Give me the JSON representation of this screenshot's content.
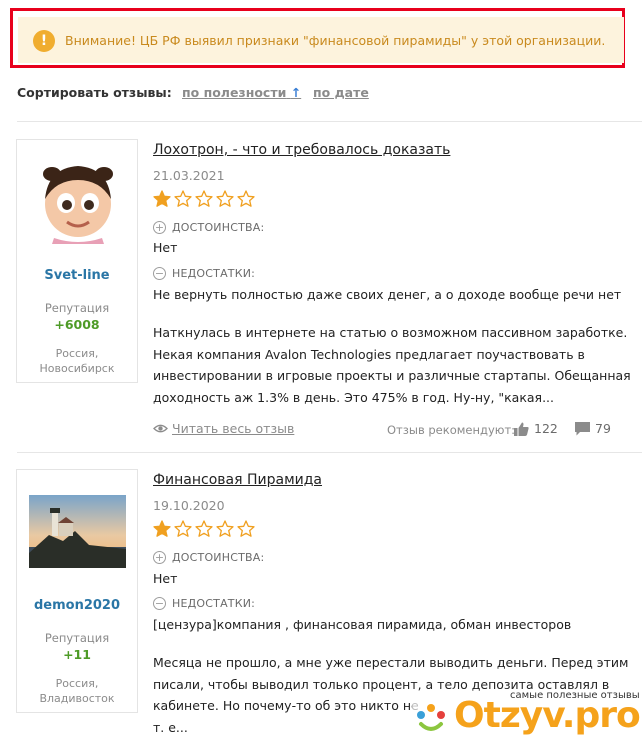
{
  "warning": {
    "icon": "exclamation-icon",
    "text": "Внимание! ЦБ РФ выявил признаки \"финансовой пирамиды\" у этой организации."
  },
  "sort": {
    "label": "Сортировать отзывы:",
    "by_usefulness": "по полезности",
    "by_date": "по дате"
  },
  "reviews": [
    {
      "author": "Svet-line",
      "rep_label": "Репутация",
      "rep_value": "+6008",
      "country": "Россия,",
      "city": "Новосибирск",
      "title": "Лохотрон, - что и требовалось доказать",
      "date": "21.03.2021",
      "rating": 1,
      "pros_label": "ДОСТОИНСТВА:",
      "pros": "Нет",
      "cons_label": "НЕДОСТАТКИ:",
      "cons": "Не вернуть полностью даже своих денег, а о доходе вообще речи нет",
      "body": [
        "Наткнулась в интернете на статью о возможном пассивном заработке.",
        "Некая компания Avalon Technologies предлагает поучаствовать в",
        "инвестировании в игровые проекты и различные стартапы. Обещанная",
        "доходность аж 1.3% в день. Это 475% в год. Ну-ну, \"какая..."
      ],
      "read_full": "Читать весь отзыв",
      "recommended_label": "Отзыв рекомендуют:",
      "likes": "122",
      "comments": "79"
    },
    {
      "author": "demon2020",
      "rep_label": "Репутация",
      "rep_value": "+11",
      "country": "Россия,",
      "city": "Владивосток",
      "title": "Финансовая Пирамида",
      "date": "19.10.2020",
      "rating": 1,
      "pros_label": "ДОСТОИНСТВА:",
      "pros": "Нет",
      "cons_label": "НЕДОСТАТКИ:",
      "cons": "[цензура]компания , финансовая пирамида, обман инвесторов",
      "body": [
        "Месяца не прошло, а мне уже перестали выводить деньги. Перед этим",
        "писали, чтобы выводил только процент, а тело депозита оставлял в",
        "кабинете. Но почему-то об это никто не",
        "т. е..."
      ]
    }
  ],
  "watermark": {
    "caption": "самые полезные отзывы",
    "logo": "Otzyv.pro"
  },
  "colors": {
    "alert_border": "#e8001c",
    "alert_bg": "#fdf3dd",
    "alert_text": "#c98a1e",
    "star": "#f0a020",
    "author_link": "#2a76a6",
    "reputation": "#4e9b27"
  }
}
